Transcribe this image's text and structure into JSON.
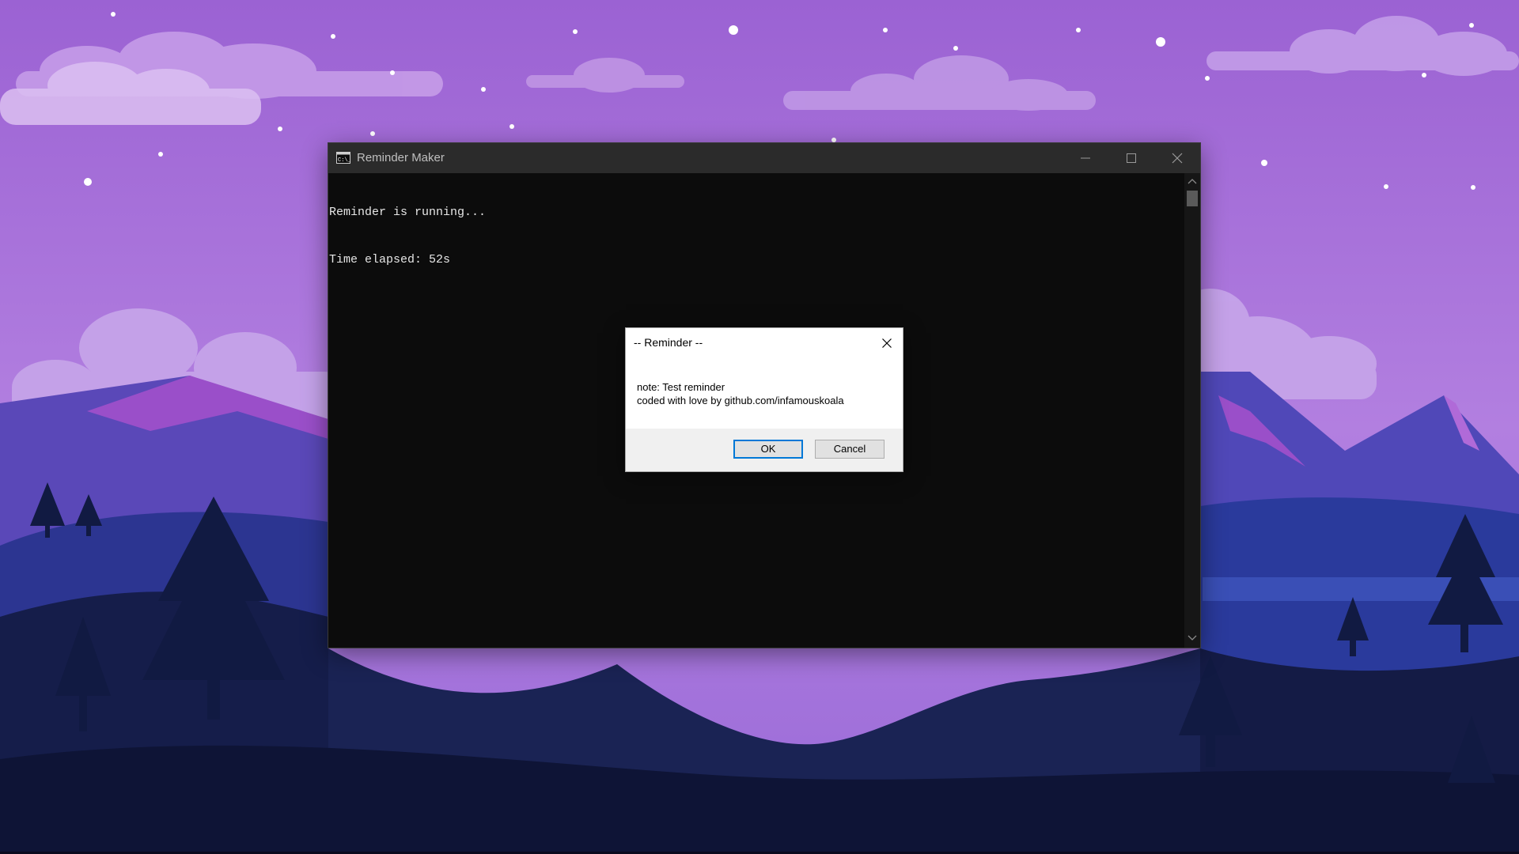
{
  "console_window": {
    "title": "Reminder Maker",
    "icon": "console-app-icon",
    "lines": [
      "Reminder is running...",
      "Time elapsed: 52s"
    ],
    "controls": {
      "minimize_icon": "minimize-icon",
      "maximize_icon": "maximize-icon",
      "close_icon": "close-icon"
    }
  },
  "dialog": {
    "title": "-- Reminder --",
    "message_lines": [
      "note: Test reminder",
      "coded with love by github.com/infamouskoala"
    ],
    "ok_label": "OK",
    "cancel_label": "Cancel",
    "close_icon": "close-icon"
  },
  "colors": {
    "sky_top": "#9f6ad6",
    "sky_bottom": "#b98ae3",
    "console_bg": "#0c0c0c",
    "titlebar_bg": "#2b2b2b",
    "dialog_footer": "#f0f0f0",
    "focus_accent": "#0078d7"
  }
}
